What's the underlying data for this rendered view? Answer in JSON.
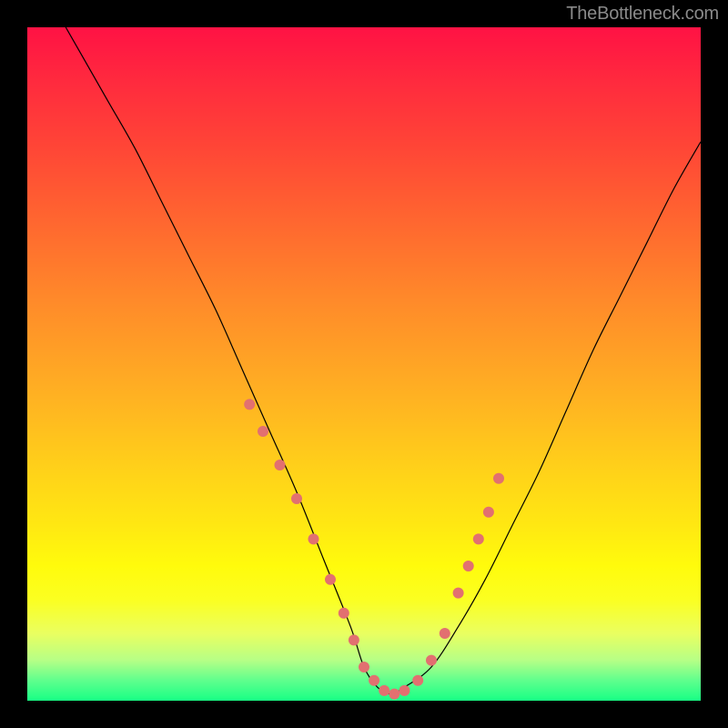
{
  "watermark": "TheBottleneck.com",
  "chart_data": {
    "type": "line",
    "title": "",
    "xlabel": "",
    "ylabel": "",
    "xlim": [
      0,
      100
    ],
    "ylim": [
      0,
      100
    ],
    "grid": false,
    "series": [
      {
        "name": "curve",
        "x": [
          0,
          4,
          8,
          12,
          16,
          20,
          24,
          28,
          32,
          36,
          40,
          44,
          48,
          50,
          52,
          54,
          56,
          60,
          64,
          68,
          72,
          76,
          80,
          84,
          88,
          92,
          96,
          100
        ],
        "y": [
          110,
          103,
          96,
          89,
          82,
          74,
          66,
          58,
          49,
          40,
          31,
          21,
          11,
          5,
          2,
          1,
          2,
          5,
          11,
          18,
          26,
          34,
          43,
          52,
          60,
          68,
          76,
          83
        ]
      }
    ],
    "marker_points": {
      "name": "markers",
      "x": [
        33,
        35,
        37.5,
        40,
        42.5,
        45,
        47,
        48.5,
        50,
        51.5,
        53,
        54.5,
        56,
        58,
        60,
        62,
        64,
        65.5,
        67,
        68.5,
        70
      ],
      "y": [
        44,
        40,
        35,
        30,
        24,
        18,
        13,
        9,
        5,
        3,
        1.5,
        1,
        1.5,
        3,
        6,
        10,
        16,
        20,
        24,
        28,
        33
      ]
    },
    "dot_radius_px": 6,
    "colors": {
      "curve": "#000000",
      "dots": "#e27070",
      "gradient_top": "#ff1244",
      "gradient_bottom": "#18ff85"
    }
  }
}
